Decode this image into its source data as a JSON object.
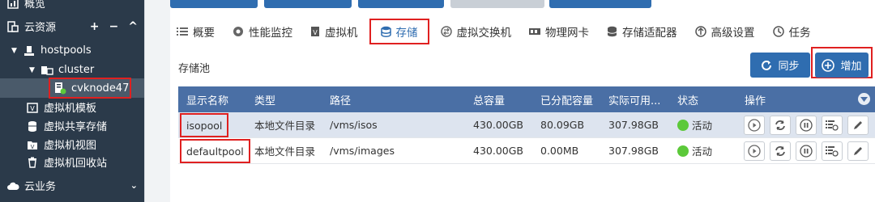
{
  "sidebar": {
    "items": [
      {
        "label": "概览",
        "icon": "dashboard-icon"
      },
      {
        "label": "云资源",
        "icon": "cloud-resource-icon",
        "tools": [
          "+",
          "−",
          "^"
        ]
      },
      {
        "label": "hostpools",
        "icon": "hostpool-icon"
      },
      {
        "label": "cluster",
        "icon": "cluster-icon"
      },
      {
        "label": "cvknode47",
        "icon": "host-node-icon"
      },
      {
        "label": "虚拟机模板",
        "icon": "vm-template-icon"
      },
      {
        "label": "虚拟共享存储",
        "icon": "shared-storage-icon"
      },
      {
        "label": "虚拟机视图",
        "icon": "vm-view-icon"
      },
      {
        "label": "虚拟机回收站",
        "icon": "recycle-bin-icon"
      },
      {
        "label": "云业务",
        "icon": "cloud-service-icon"
      }
    ]
  },
  "tabs": [
    {
      "label": "概要",
      "icon": "list-icon"
    },
    {
      "label": "性能监控",
      "icon": "monitor-icon"
    },
    {
      "label": "虚拟机",
      "icon": "vm-icon"
    },
    {
      "label": "存储",
      "icon": "database-icon",
      "active": true
    },
    {
      "label": "虚拟交换机",
      "icon": "vswitch-icon"
    },
    {
      "label": "物理网卡",
      "icon": "nic-icon"
    },
    {
      "label": "存储适配器",
      "icon": "storage-adapter-icon"
    },
    {
      "label": "高级设置",
      "icon": "advanced-icon"
    },
    {
      "label": "任务",
      "icon": "task-icon"
    }
  ],
  "section_title": "存储池",
  "buttons": {
    "sync": "同步",
    "add": "增加"
  },
  "table": {
    "headers": [
      "显示名称",
      "类型",
      "路径",
      "总容量",
      "已分配容量",
      "实际可用...",
      "状态",
      "操作"
    ],
    "rows": [
      {
        "name": "isopool",
        "type": "本地文件目录",
        "path": "/vms/isos",
        "total": "430.00GB",
        "allocated": "80.09GB",
        "available": "307.98GB",
        "status": "活动"
      },
      {
        "name": "defaultpool",
        "type": "本地文件目录",
        "path": "/vms/images",
        "total": "430.00GB",
        "allocated": "0.00MB",
        "available": "307.98GB",
        "status": "活动"
      }
    ]
  },
  "colors": {
    "accent": "#2f6db0",
    "sidebar_bg": "#2b3a4a",
    "header_bg": "#4a6fa5",
    "highlight": "#e02020",
    "status_active": "#5cc93a"
  }
}
